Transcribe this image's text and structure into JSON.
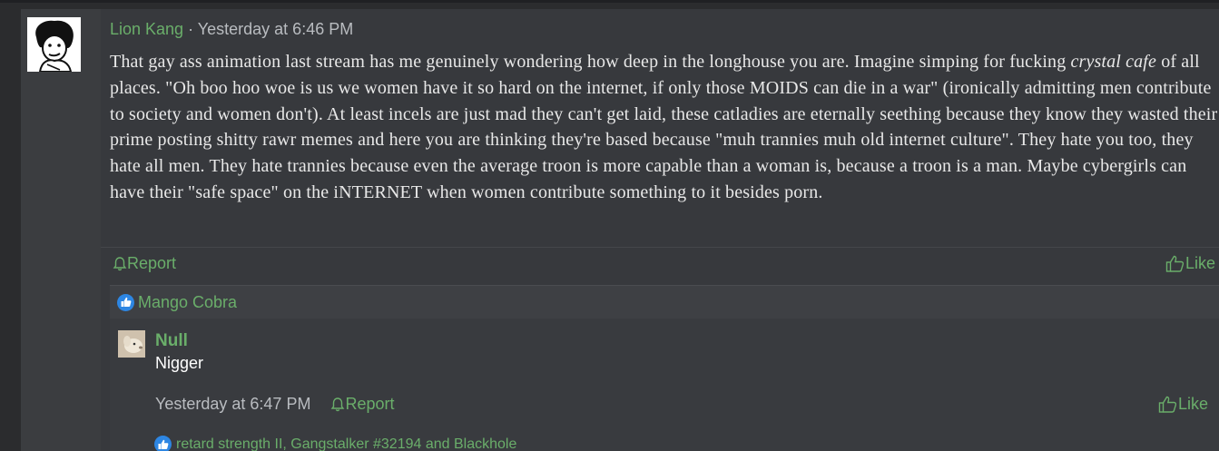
{
  "post": {
    "author": "Lion Kang",
    "separator": "·",
    "timestamp": "Yesterday at 6:46 PM",
    "body_part1": "That gay ass animation last stream has me genuinely wondering how deep in the longhouse you are. Imagine simping for fucking ",
    "body_italic": "crystal cafe",
    "body_part2": " of all places. \"Oh boo hoo woe is us we women have it so hard on the internet, if only those MOIDS can die in a war\" (ironically admitting men contribute to society and women don't). At least incels are just mad they can't get laid, these catladies are eternally seething because they know they wasted their prime posting shitty rawr memes and here you are thinking they're based because \"muh trannies muh old internet culture\". They hate you too, they hate all men. They hate trannies because even the average troon is more capable than a woman is, because a troon is a man. Maybe cybergirls can have their \"safe space\" on the iNTERNET when women contribute something to it besides porn.",
    "report_label": "Report",
    "like_label": "Like",
    "reactions": {
      "icon": "thumbs-up-reaction-icon",
      "names": "Mango Cobra"
    }
  },
  "comment": {
    "author": "Null",
    "text": "Nigger",
    "timestamp": "Yesterday at 6:47 PM",
    "report_label": "Report",
    "like_label": "Like",
    "reactions": {
      "icon": "thumbs-up-reaction-icon",
      "names": "retard strength II, Gangstalker #32194 and Blackhole"
    }
  },
  "colors": {
    "accent_green": "#6aae6a",
    "reaction_blue": "#2d86e3",
    "body_text": "#e8e8e8",
    "muted_text": "#b9bcc0"
  }
}
